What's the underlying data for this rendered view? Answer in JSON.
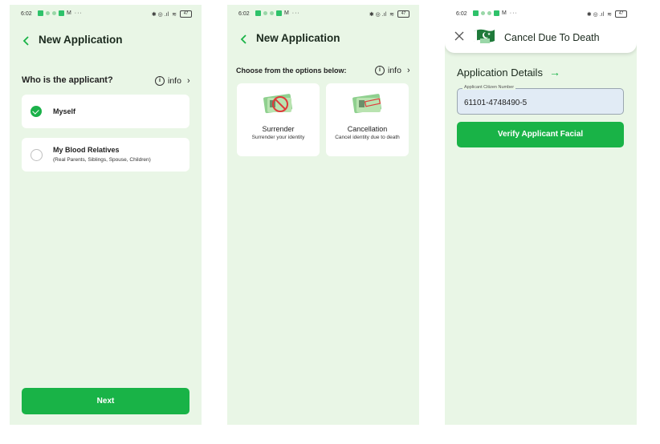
{
  "status_bar": {
    "time": "6:02",
    "battery": "47"
  },
  "screen1": {
    "title": "New Application",
    "question": "Who is the applicant?",
    "info_label": "info",
    "options": [
      {
        "title": "Myself",
        "subtitle": "",
        "selected": true
      },
      {
        "title": "My Blood Relatives",
        "subtitle": "(Real Parents, Siblings, Spouse, Children)",
        "selected": false
      }
    ],
    "next_label": "Next"
  },
  "screen2": {
    "title": "New Application",
    "choose_label": "Choose from the options below:",
    "info_label": "info",
    "options": [
      {
        "title": "Surrender",
        "subtitle": "Surrender your identity"
      },
      {
        "title": "Cancellation",
        "subtitle": "Cancel identity due to death"
      }
    ]
  },
  "screen3": {
    "title": "Cancel Due To Death",
    "section_title": "Application Details",
    "field_label": "Applicant Citizen Number",
    "field_value": "61101-4748490-5",
    "verify_label": "Verify Applicant Facial"
  },
  "colors": {
    "accent": "#19b347",
    "background": "#e9f6e6",
    "card": "#ffffff"
  }
}
